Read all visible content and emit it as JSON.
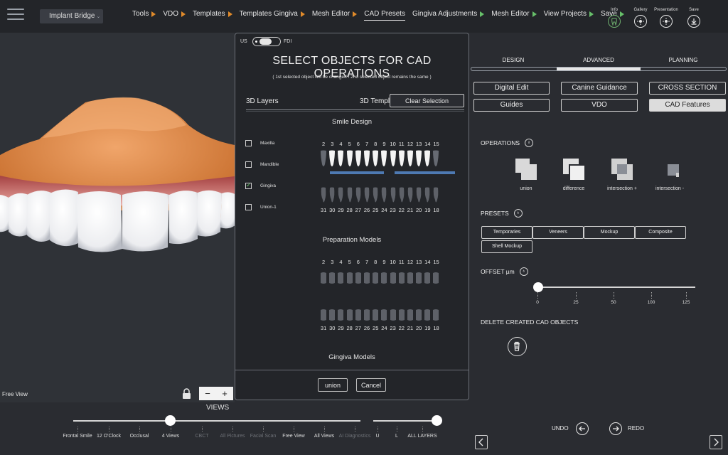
{
  "app": {
    "project": "Implant Bridge"
  },
  "nav": [
    {
      "label": "Tools",
      "active": false
    },
    {
      "label": "VDO",
      "active": false
    },
    {
      "label": "Templates",
      "active": false
    },
    {
      "label": "Templates Gingiva",
      "active": false
    },
    {
      "label": "Mesh Editor",
      "active": false
    },
    {
      "label": "CAD Presets",
      "active": true
    },
    {
      "label": "Gingiva Adjustments",
      "active": false
    },
    {
      "label": "Mesh Editor",
      "active": false
    },
    {
      "label": "View Projects",
      "active": false
    },
    {
      "label": "Save",
      "active": false
    }
  ],
  "top_tools": {
    "info": "Info",
    "gallery": "Gallery",
    "presentation": "Presentation",
    "save": "Save"
  },
  "viewport": {
    "label": "Free View",
    "zoom_minus": "−",
    "zoom_plus": "+"
  },
  "modal": {
    "toggle_left": "US",
    "toggle_right": "FDI",
    "title": "SELECT OBJECTS FOR CAD OPERATIONS",
    "subtitle": "( 1st selected object will be changed / 2nd selected object remains the same )",
    "tab_layers": "3D Layers",
    "tab_templates": "3D Templates",
    "clear_selection": "Clear Selection",
    "smile_design": "Smile Design",
    "preparation_models": "Preparation Models",
    "gingiva_models": "Gingiva Models",
    "layers": [
      {
        "label": "Maxilla",
        "checked": false
      },
      {
        "label": "Mandible",
        "checked": false
      },
      {
        "label": "Gingiva",
        "checked": true
      },
      {
        "label": "Union-1",
        "checked": false
      }
    ],
    "upper_teeth": [
      "2",
      "3",
      "4",
      "5",
      "6",
      "7",
      "8",
      "9",
      "10",
      "11",
      "12",
      "13",
      "14",
      "15"
    ],
    "lower_teeth": [
      "31",
      "30",
      "29",
      "28",
      "27",
      "26",
      "25",
      "24",
      "23",
      "22",
      "21",
      "20",
      "19",
      "18"
    ],
    "btn_union": "union",
    "btn_cancel": "Cancel"
  },
  "right_panel": {
    "tabs": {
      "design": "DESIGN",
      "advanced": "ADVANCED",
      "planning": "PLANNING"
    },
    "buttons": {
      "digital_edit": "Digital Edit",
      "canine_guidance": "Canine Guidance",
      "cross_section": "CROSS SECTION",
      "guides": "Guides",
      "vdo": "VDO",
      "cad_features": "CAD Features"
    },
    "operations_title": "OPERATIONS",
    "operations": {
      "union": "union",
      "difference": "difference",
      "intersection_plus": "intersection +",
      "intersection_minus": "intersection -"
    },
    "presets_title": "PRESETS",
    "presets": {
      "temporaries": "Temporaries",
      "veneers": "Veneers",
      "mockup": "Mockup",
      "composite": "Composite",
      "shell_mockup": "Shell Mockup"
    },
    "offset_title": "OFFSET µm",
    "offset_ticks": [
      "0",
      "25",
      "50",
      "100",
      "125"
    ],
    "offset_value": 0,
    "delete_title": "DELETE CREATED CAD OBJECTS"
  },
  "bottom": {
    "views_label": "VIEWS",
    "views": [
      {
        "label": "Frontal Smile",
        "dim": false
      },
      {
        "label": "12 O'Clock",
        "dim": false
      },
      {
        "label": "Occlusal",
        "dim": false
      },
      {
        "label": "4 Views",
        "dim": false
      },
      {
        "label": "CBCT",
        "dim": true
      },
      {
        "label": "All Pictures",
        "dim": true
      },
      {
        "label": "Facial Scan",
        "dim": true
      },
      {
        "label": "Free View",
        "dim": false
      },
      {
        "label": "All Views",
        "dim": false
      },
      {
        "label": "AI Diagnostics",
        "dim": true
      }
    ],
    "layers": {
      "u": "U",
      "l": "L",
      "all": "ALL LAYERS"
    },
    "undo": "UNDO",
    "redo": "REDO"
  }
}
